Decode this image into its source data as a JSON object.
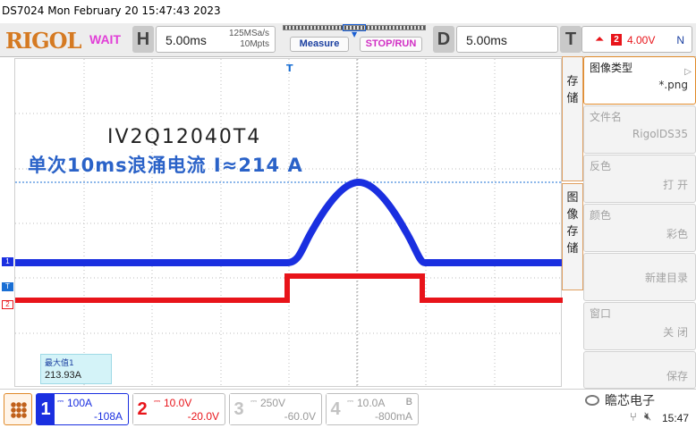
{
  "titlebar": {
    "text": "DS7024  Mon February 20 15:47:43 2023"
  },
  "topbar": {
    "brand": "RIGOL",
    "status": "WAIT",
    "horizontal": {
      "key": "H",
      "scale": "5.00ms",
      "sample_rate": "125MSa/s",
      "memory": "10Mpts"
    },
    "measure_label": "Measure",
    "stoprun_label": "STOP/RUN",
    "delay": {
      "key": "D",
      "value": "5.00ms"
    },
    "trigger": {
      "key": "T",
      "source": "2",
      "level": "4.00V",
      "mode": "N"
    }
  },
  "screen": {
    "annotation_title": "IV2Q12040T4",
    "annotation_text": "单次10ms浪涌电流 I≈214 A",
    "measurement": {
      "label": "最大值1",
      "value": "213.93A"
    },
    "markers": {
      "ch1": "1",
      "trigger": "T",
      "ch2": "2",
      "top_trigger": "T"
    },
    "trace_colors": {
      "ch1": "#1a2fe0",
      "ch2": "#e8141a"
    }
  },
  "side_menu": {
    "tab_storage": "存\n储",
    "tab_image_storage": "图\n像\n存\n储",
    "items": [
      {
        "label": "图像类型",
        "value": "*.png"
      },
      {
        "label": "文件名",
        "value": "RigolDS35"
      },
      {
        "label": "反色",
        "value": "打 开"
      },
      {
        "label": "颜色",
        "value": "彩色"
      },
      {
        "label": "",
        "value": "新建目录"
      },
      {
        "label": "窗口",
        "value": "关 闭"
      },
      {
        "label": "",
        "value": "保存"
      }
    ]
  },
  "channels": [
    {
      "num": "1",
      "scale": "100A",
      "offset": "-108A",
      "color": "#1a2fe0"
    },
    {
      "num": "2",
      "scale": "10.0V",
      "offset": "-20.0V",
      "color": "#e8141a"
    },
    {
      "num": "3",
      "scale": "250V",
      "offset": "-60.0V",
      "color": "#bdbdbd"
    },
    {
      "num": "4",
      "scale": "10.0A",
      "offset": "-800mA",
      "bw": "B",
      "color": "#bdbdbd"
    }
  ],
  "statusbar": {
    "watermark": "瞻芯电子",
    "time": "15:47"
  }
}
